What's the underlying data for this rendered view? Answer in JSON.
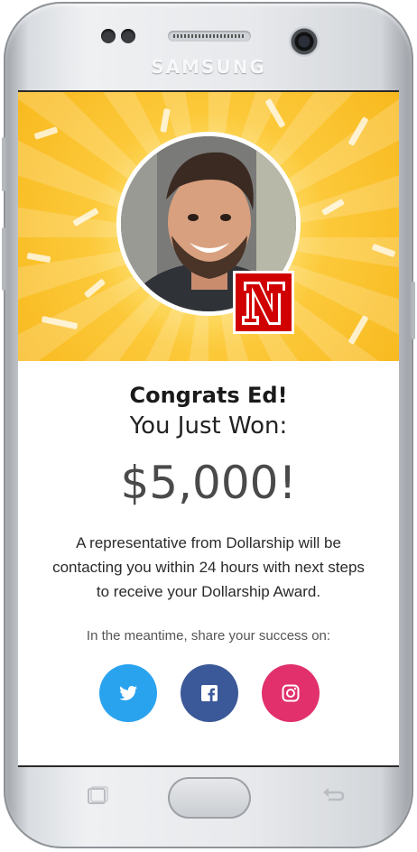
{
  "device": {
    "brand": "SAMSUNG"
  },
  "banner": {
    "avatar_label": "winner-photo",
    "school_logo_letter": "N",
    "colors": {
      "background": "#fcc93a",
      "logo_red": "#d00000"
    }
  },
  "award": {
    "greeting": "Congrats Ed!",
    "headline": "You Just Won:",
    "amount": "$5,000!",
    "message": "A representative from Dollarship will be contacting you within 24 hours with next steps to receive your Dollarship Award.",
    "share_prompt": "In the meantime, share your success on:"
  },
  "social": [
    {
      "name": "twitter-icon",
      "color": "#2aa3ef"
    },
    {
      "name": "facebook-icon",
      "color": "#3b5998"
    },
    {
      "name": "instagram-icon",
      "color": "#e1306c"
    }
  ]
}
